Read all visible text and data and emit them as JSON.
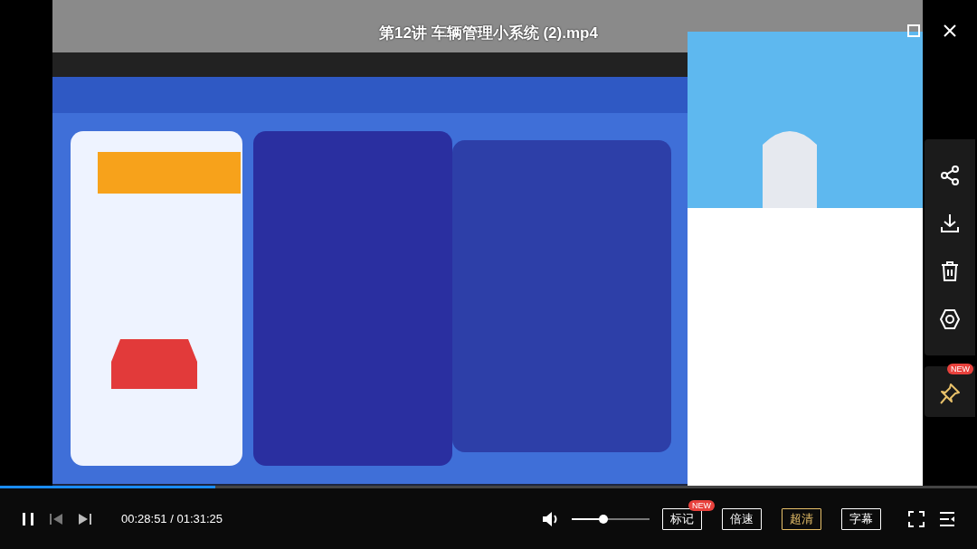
{
  "player": {
    "title": "第12讲 车辆管理小系统 (2).mp4"
  },
  "side_actions": [
    {
      "kind": "share"
    },
    {
      "kind": "download"
    },
    {
      "kind": "delete"
    },
    {
      "kind": "view"
    }
  ],
  "pin": {
    "badge": "NEW"
  },
  "progress": {
    "level": 0.22
  },
  "controls": {
    "playing": true,
    "time": "00:28:51 / 01:31:25",
    "volume": {
      "level": 0.41
    }
  },
  "buttons": [
    {
      "label": "标记",
      "badge": "NEW",
      "selected": false
    },
    {
      "label": "倍速",
      "selected": false
    },
    {
      "label": "超清",
      "selected": true
    },
    {
      "label": "字幕",
      "selected": false
    }
  ]
}
